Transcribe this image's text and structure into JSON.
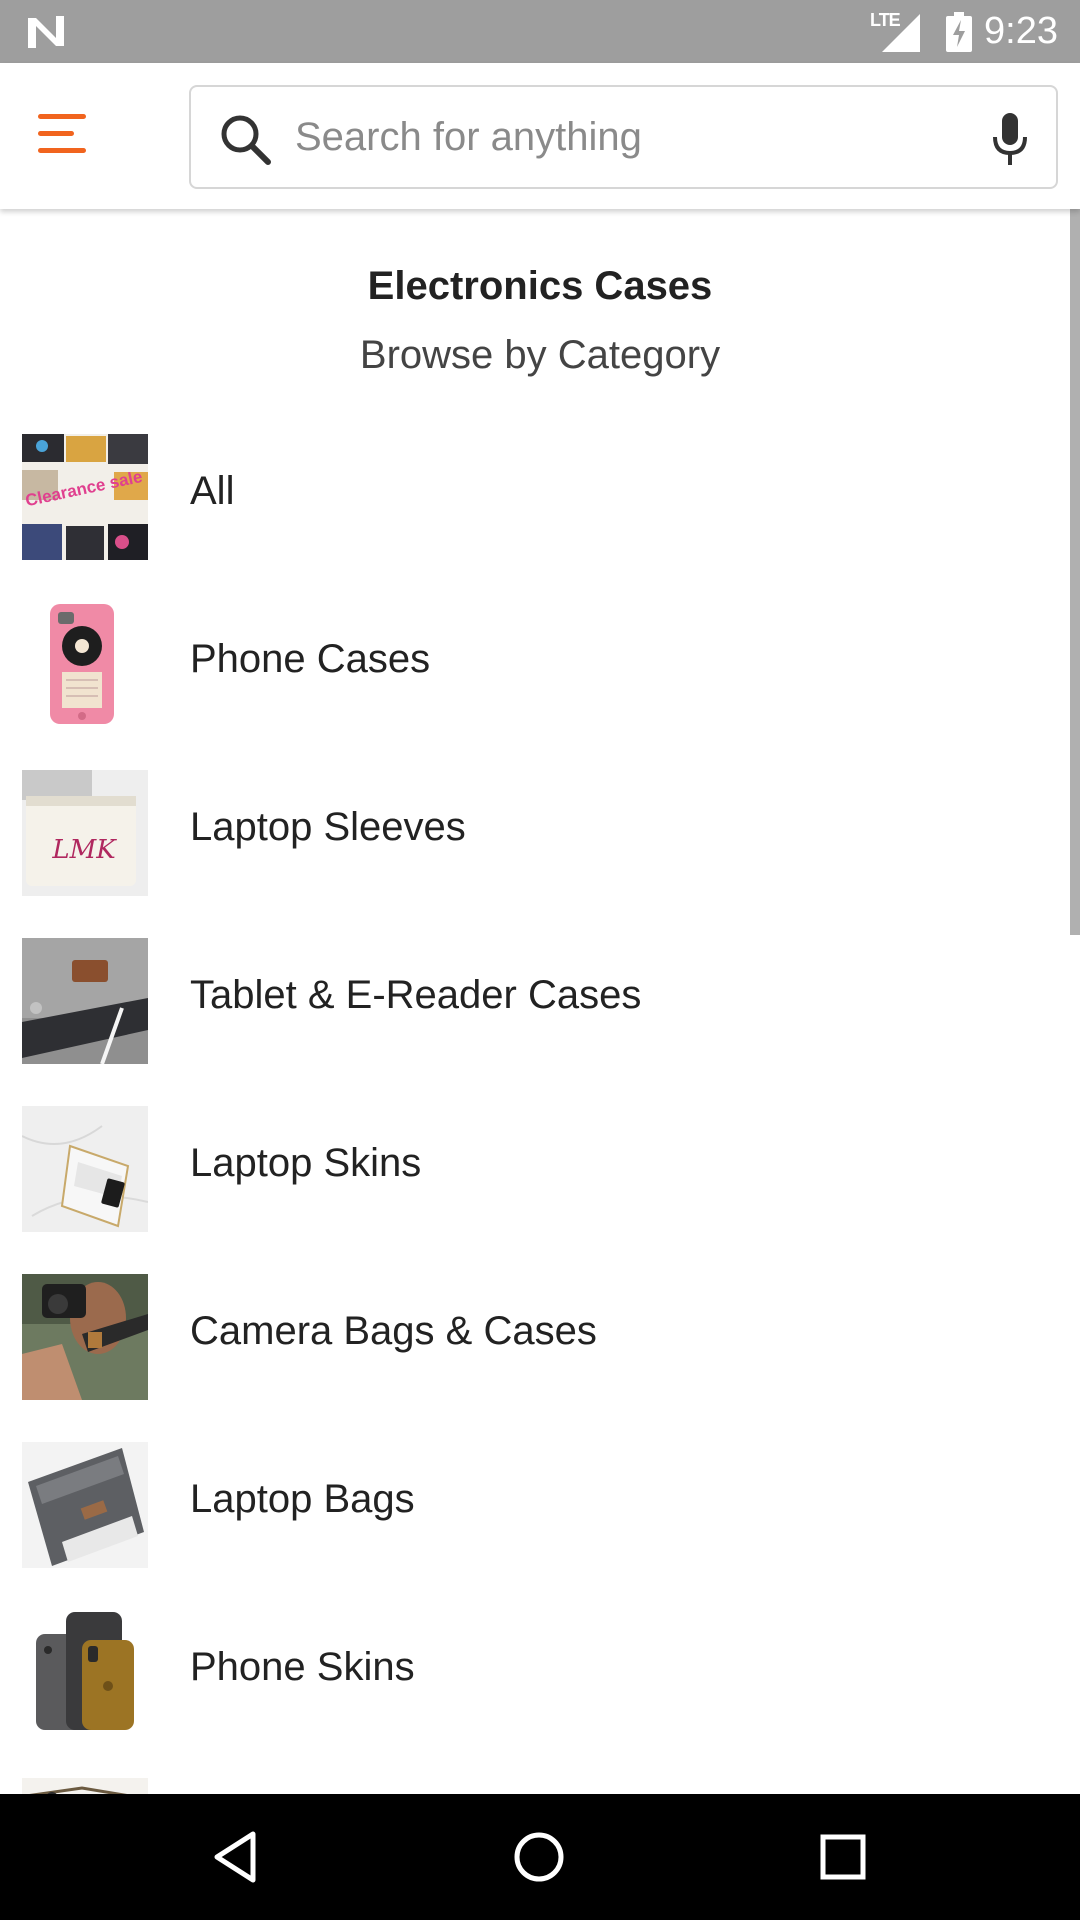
{
  "status_bar": {
    "time": "9:23",
    "network": "LTE"
  },
  "header": {
    "search_placeholder": "Search for anything",
    "icons": [
      "menu-icon",
      "search-icon",
      "mic-icon"
    ],
    "accent_color": "#f1641e"
  },
  "page": {
    "title": "Electronics Cases",
    "subtitle": "Browse by Category"
  },
  "categories": [
    {
      "label": "All",
      "thumbnail_text": "Clearance sale"
    },
    {
      "label": "Phone Cases"
    },
    {
      "label": "Laptop Sleeves",
      "thumbnail_text": "LMK"
    },
    {
      "label": "Tablet & E-Reader Cases"
    },
    {
      "label": "Laptop Skins"
    },
    {
      "label": "Camera Bags & Cases"
    },
    {
      "label": "Laptop Bags"
    },
    {
      "label": "Phone Skins"
    }
  ],
  "nav_bar": {
    "icons": [
      "back-icon",
      "home-icon",
      "recents-icon"
    ]
  }
}
